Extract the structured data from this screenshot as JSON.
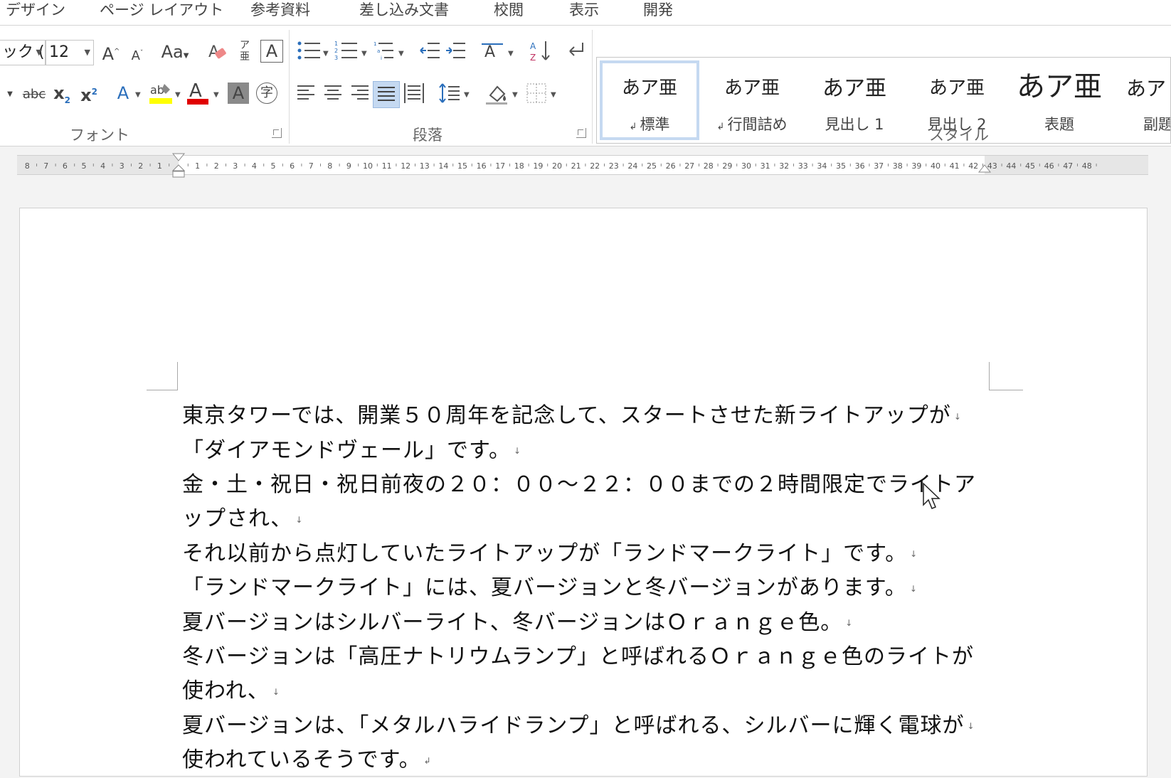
{
  "tabs": [
    "デザイン",
    "ページ レイアウト",
    "参考資料",
    "差し込み文書",
    "校閲",
    "表示",
    "開発"
  ],
  "font": {
    "name_value": "ック (",
    "size_value": "12",
    "group_label": "フォント",
    "case_label": "Aa",
    "highlight_color": "#ffff00",
    "font_color": "#e00000"
  },
  "paragraph": {
    "group_label": "段落"
  },
  "styles": {
    "group_label": "スタイル",
    "items": [
      {
        "sample": "あア亜",
        "name": "標準"
      },
      {
        "sample": "あア亜",
        "name": "行間詰め"
      },
      {
        "sample": "あア亜",
        "name": "見出し 1"
      },
      {
        "sample": "あア亜",
        "name": "見出し 2"
      },
      {
        "sample": "あア亜",
        "name": "表題"
      },
      {
        "sample": "あア",
        "name": "副題"
      }
    ]
  },
  "ruler": {
    "left_numbers": [
      "8",
      "7",
      "6",
      "5",
      "4",
      "3",
      "2",
      "1"
    ],
    "right_numbers": [
      "1",
      "2",
      "3",
      "4",
      "5",
      "6",
      "7",
      "8",
      "9",
      "10",
      "11",
      "12",
      "13",
      "14",
      "15",
      "16",
      "17",
      "18",
      "19",
      "20",
      "21",
      "22",
      "23",
      "24",
      "25",
      "26",
      "27",
      "28",
      "29",
      "30",
      "31",
      "32",
      "33",
      "34",
      "35",
      "36",
      "37",
      "38",
      "39",
      "40",
      "41",
      "42",
      "43",
      "44",
      "45",
      "46",
      "47",
      "48"
    ]
  },
  "document": {
    "paragraphs": [
      "東京タワーでは、開業５０周年を記念して、スタートさせた新ライトアップが",
      "「ダイアモンドヴェール」です。",
      "金・土・祝日・祝日前夜の２０：００～２２：００までの２時間限定でライトア",
      "ップされ、",
      "それ以前から点灯していたライトアップが「ランドマークライト」です。",
      "「ランドマークライト」には、夏バージョンと冬バージョンがあります。",
      "夏バージョンはシルバーライト、冬バージョンはＯｒａｎｇｅ色。",
      "冬バージョンは「高圧ナトリウムランプ」と呼ばれるＯｒａｎｇｅ色のライトが",
      "使われ、",
      "夏バージョンは、「メタルハライドランプ」と呼ばれる、シルバーに輝く電球が",
      "使われているそうです。"
    ]
  }
}
